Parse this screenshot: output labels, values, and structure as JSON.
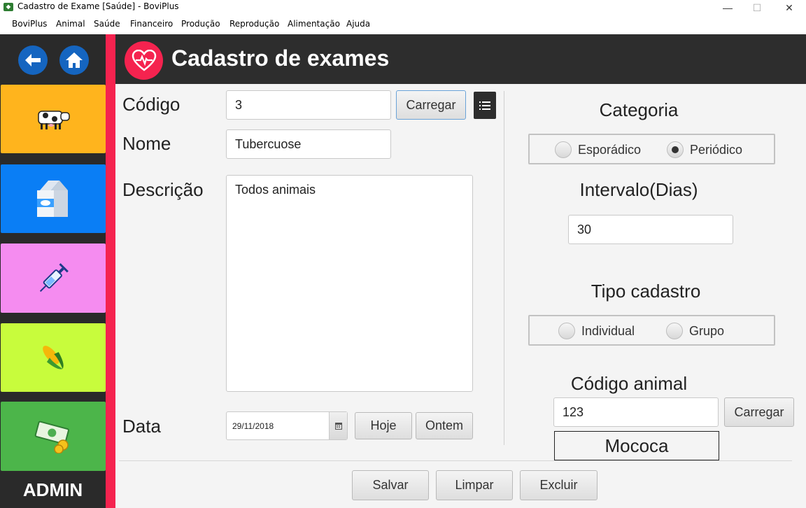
{
  "window": {
    "title": "Cadastro de Exame [Saúde] - BoviPlus",
    "controls": {
      "minimize": "—",
      "maximize": "☐",
      "close": "✕"
    }
  },
  "menu": [
    "BoviPlus",
    "Animal",
    "Saúde",
    "Financeiro",
    "Produção",
    "Reprodução",
    "Alimentação",
    "Ajuda"
  ],
  "sidebar": {
    "tiles": [
      {
        "name": "cattle",
        "color": "#ffb41d"
      },
      {
        "name": "milk",
        "color": "#0a7ef5"
      },
      {
        "name": "health",
        "color": "#f58cf0"
      },
      {
        "name": "feed",
        "color": "#c8fc3c"
      },
      {
        "name": "finance",
        "color": "#4cb54a"
      }
    ],
    "admin_label": "ADMIN"
  },
  "header": {
    "title": "Cadastro de exames"
  },
  "form": {
    "codigo_label": "Código",
    "codigo_value": "3",
    "carregar_label": "Carregar",
    "nome_label": "Nome",
    "nome_value": "Tubercuose",
    "descricao_label": "Descrição",
    "descricao_value": "Todos animais",
    "data_label": "Data",
    "data_value": "29/11/2018",
    "hoje_label": "Hoje",
    "ontem_label": "Ontem"
  },
  "right": {
    "categoria_label": "Categoria",
    "esporadico_label": "Esporádico",
    "periodico_label": "Periódico",
    "intervalo_label": "Intervalo(Dias)",
    "intervalo_value": "30",
    "tipo_label": "Tipo cadastro",
    "individual_label": "Individual",
    "grupo_label": "Grupo",
    "codigo_animal_label": "Código animal",
    "codigo_animal_value": "123",
    "carregar_label": "Carregar",
    "animal_name": "Mococa"
  },
  "actions": {
    "salvar": "Salvar",
    "limpar": "Limpar",
    "excluir": "Excluir"
  }
}
